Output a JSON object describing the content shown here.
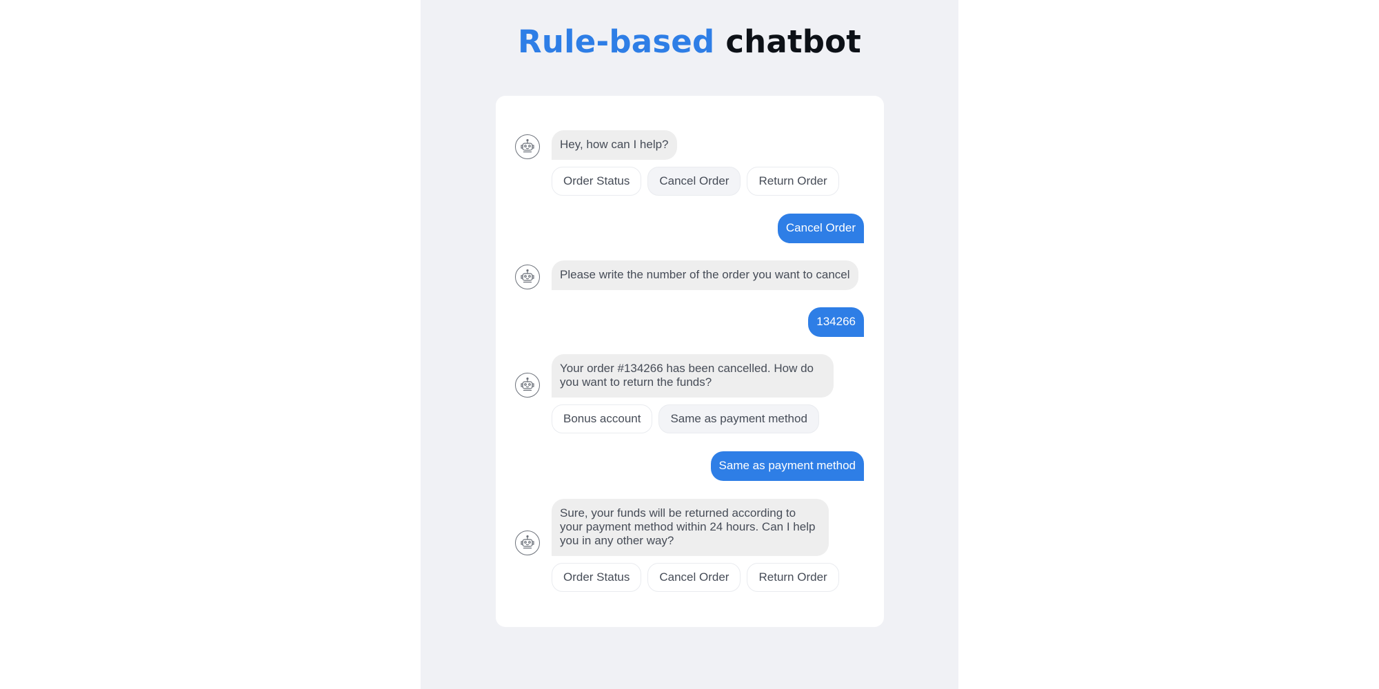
{
  "title": {
    "accent": "Rule-based",
    "rest": "chatbot"
  },
  "colors": {
    "accent": "#2e7ee6",
    "panel_bg": "#f0f1f5",
    "bot_bubble": "#eeeeee",
    "user_bubble": "#2e7ee6"
  },
  "conversation": {
    "m1": {
      "sender": "bot",
      "text": "Hey, how can I help?",
      "options": [
        "Order Status",
        "Cancel Order",
        "Return Order"
      ],
      "selected_option": "Cancel Order"
    },
    "m2": {
      "sender": "user",
      "text": "Cancel Order"
    },
    "m3": {
      "sender": "bot",
      "text": "Please write the number of the order you want to cancel"
    },
    "m4": {
      "sender": "user",
      "text": "134266"
    },
    "m5": {
      "sender": "bot",
      "text": "Your order #134266 has been cancelled. How do you want to return the funds?",
      "options": [
        "Bonus account",
        "Same as payment method"
      ],
      "selected_option": "Same as payment method"
    },
    "m6": {
      "sender": "user",
      "text": "Same as payment method"
    },
    "m7": {
      "sender": "bot",
      "text": "Sure, your funds will be returned according to your payment method within 24 hours. Can I help you in any other way?",
      "options": [
        "Order Status",
        "Cancel Order",
        "Return Order"
      ],
      "selected_option": null
    }
  },
  "icons": {
    "bot_avatar": "robot-icon"
  }
}
